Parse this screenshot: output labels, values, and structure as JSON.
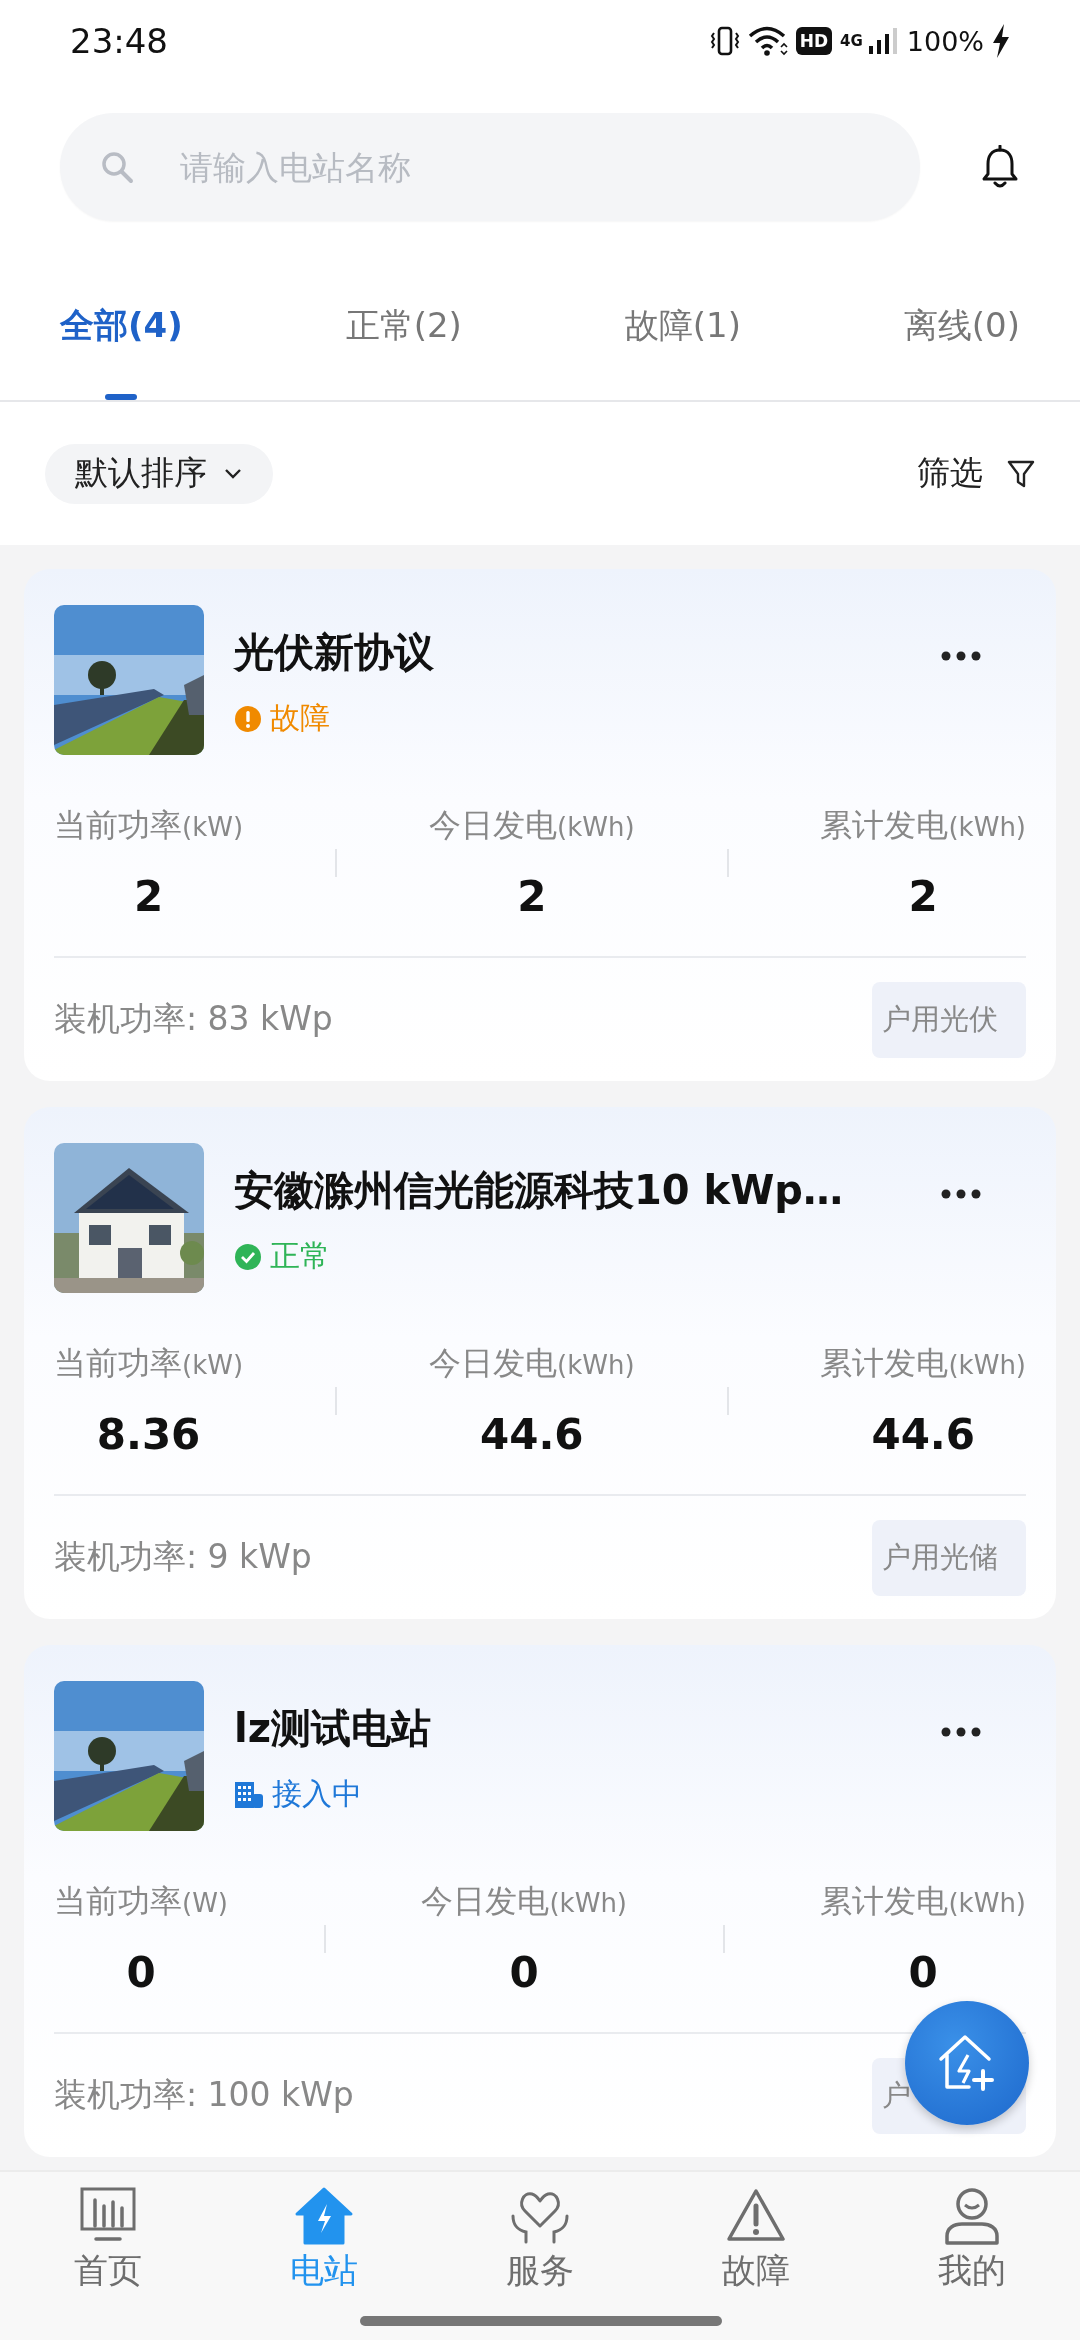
{
  "status_bar": {
    "time": "23:48",
    "hd": "HD",
    "network": "4G",
    "battery": "100%",
    "charging": true
  },
  "search": {
    "placeholder": "请输入电站名称"
  },
  "tabs": [
    {
      "label": "全部(4)",
      "selected": true
    },
    {
      "label": "正常(2)",
      "selected": false
    },
    {
      "label": "故障(1)",
      "selected": false
    },
    {
      "label": "离线(0)",
      "selected": false
    }
  ],
  "sort": {
    "label": "默认排序"
  },
  "filter": {
    "label": "筛选"
  },
  "stations": [
    {
      "name": "光伏新协议",
      "status": {
        "kind": "fault",
        "label": "故障"
      },
      "metrics": [
        {
          "label": "当前功率",
          "unit": "(kW)",
          "value": "2"
        },
        {
          "label": "今日发电",
          "unit": "(kWh)",
          "value": "2"
        },
        {
          "label": "累计发电",
          "unit": "(kWh)",
          "value": "2"
        }
      ],
      "capacity": "装机功率: 83 kWp",
      "tag": "户用光伏"
    },
    {
      "name": "安徽滁州信光能源科技10 kWp…",
      "status": {
        "kind": "normal",
        "label": "正常"
      },
      "metrics": [
        {
          "label": "当前功率",
          "unit": "(kW)",
          "value": "8.36"
        },
        {
          "label": "今日发电",
          "unit": "(kWh)",
          "value": "44.6"
        },
        {
          "label": "累计发电",
          "unit": "(kWh)",
          "value": "44.6"
        }
      ],
      "capacity": "装机功率: 9 kWp",
      "tag": "户用光储"
    },
    {
      "name": "lz测试电站",
      "status": {
        "kind": "connecting",
        "label": "接入中"
      },
      "metrics": [
        {
          "label": "当前功率",
          "unit": "(W)",
          "value": "0"
        },
        {
          "label": "今日发电",
          "unit": "(kWh)",
          "value": "0"
        },
        {
          "label": "累计发电",
          "unit": "(kWh)",
          "value": "0"
        }
      ],
      "capacity": "装机功率: 100 kWp",
      "tag": "户"
    }
  ],
  "nav": [
    {
      "label": "首页",
      "kind": "home",
      "selected": false
    },
    {
      "label": "电站",
      "kind": "station",
      "selected": true
    },
    {
      "label": "服务",
      "kind": "service",
      "selected": false
    },
    {
      "label": "故障",
      "kind": "fault",
      "selected": false
    },
    {
      "label": "我的",
      "kind": "profile",
      "selected": false
    }
  ]
}
